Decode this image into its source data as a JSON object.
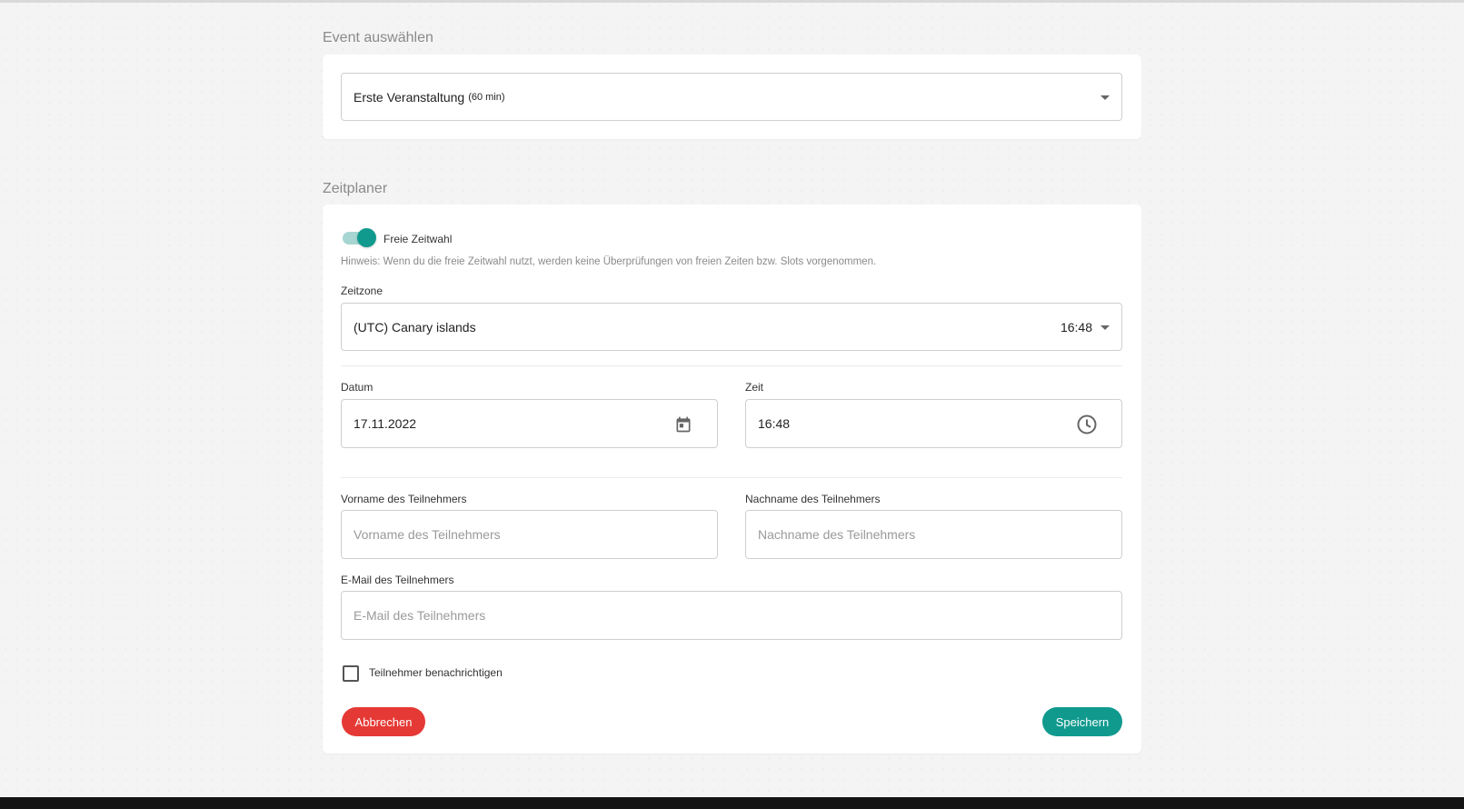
{
  "event_section": {
    "title": "Event auswählen",
    "selected_event": "Erste Veranstaltung",
    "selected_event_duration": "(60 min)"
  },
  "scheduler": {
    "title": "Zeitplaner",
    "free_time_toggle": {
      "label": "Freie Zeitwahl",
      "on": true
    },
    "hint": "Hinweis: Wenn du die freie Zeitwahl nutzt, werden keine Überprüfungen von freien Zeiten bzw. Slots vorgenommen.",
    "timezone": {
      "label": "Zeitzone",
      "value": "(UTC) Canary islands",
      "time": "16:48"
    },
    "date": {
      "label": "Datum",
      "value": "17.11.2022"
    },
    "time": {
      "label": "Zeit",
      "value": "16:48"
    },
    "first_name": {
      "label": "Vorname des Teilnehmers",
      "placeholder": "Vorname des Teilnehmers"
    },
    "last_name": {
      "label": "Nachname des Teilnehmers",
      "placeholder": "Nachname des Teilnehmers"
    },
    "email": {
      "label": "E-Mail des Teilnehmers",
      "placeholder": "E-Mail des Teilnehmers"
    },
    "notify_checkbox": {
      "label": "Teilnehmer benachrichtigen",
      "checked": false
    },
    "cancel_label": "Abbrechen",
    "save_label": "Speichern"
  },
  "colors": {
    "accent": "#109a8e",
    "danger": "#e53935"
  }
}
